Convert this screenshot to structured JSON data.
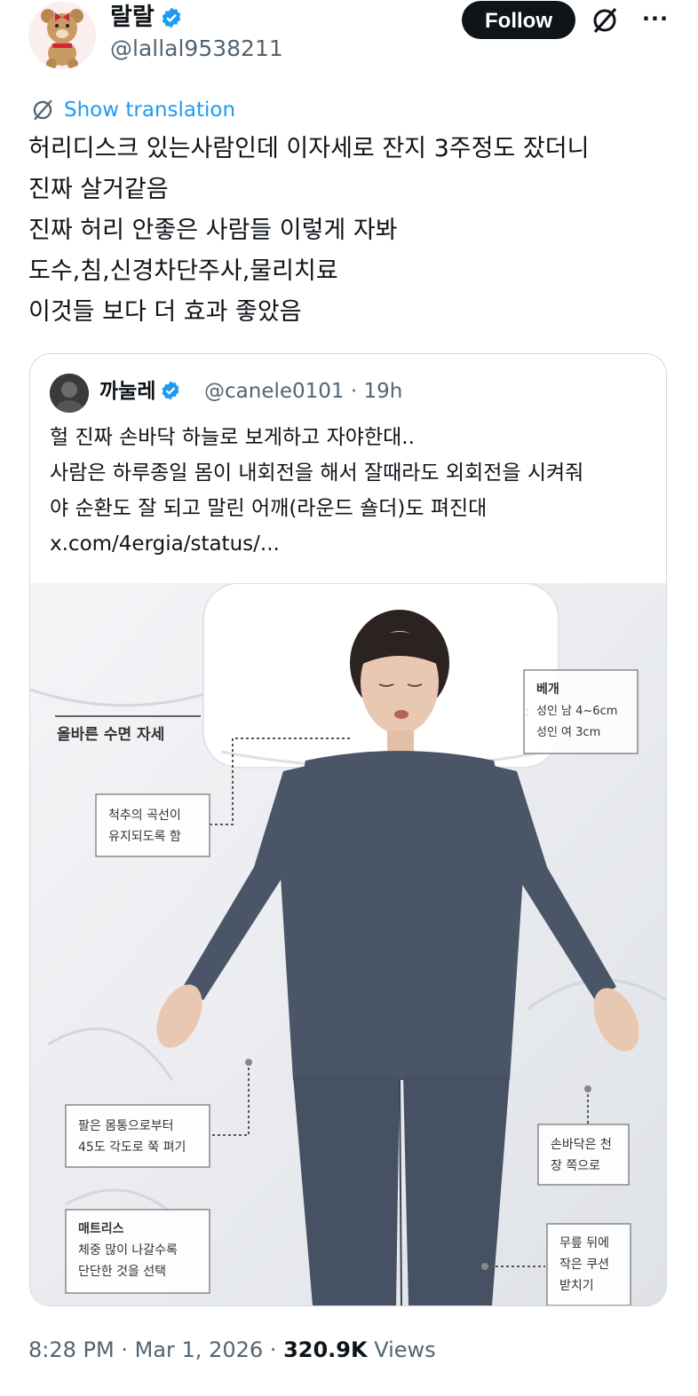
{
  "author": {
    "display_name": "랄랄",
    "handle": "@lallal9538211",
    "avatar_icon": "teddy-bear-avatar",
    "verified_icon": "verified-badge-icon"
  },
  "header": {
    "follow_label": "Follow",
    "grok_icon": "grok-icon",
    "more_label": "···"
  },
  "translation": {
    "icon": "grok-icon",
    "label": "Show translation"
  },
  "post": {
    "lines": [
      "허리디스크 있는사람인데 이자세로 잔지 3주정도 잤더니",
      "진짜 살거같음",
      "진짜 허리 안좋은 사람들 이렇게 자봐",
      "도수,침,신경차단주사,물리치료",
      "이것들 보다 더 효과 좋았음"
    ]
  },
  "quote": {
    "display_name": "까눌레",
    "handle": "@canele0101",
    "separator": "·",
    "time": "19h",
    "lines": [
      "헐 진짜 손바닥 하늘로 보게하고 자야한대..",
      "사람은 하루종일 몸이 내회전을 해서 잘때라도 외회전을 시켜줘",
      "야 순환도 잘 되고 말린 어깨(라운드 숄더)도 펴진대",
      "x.com/4ergia/status/..."
    ],
    "image": {
      "title": "올바른 수면 자세",
      "pillow_title": "베개",
      "pillow_line1": "성인 남 4~6cm",
      "pillow_line2": "성인 여 3cm",
      "spine_line1": "척추의 곡선이",
      "spine_line2": "유지되도록 함",
      "arm_line1": "팔은 몸통으로부터",
      "arm_line2": "45도 각도로 쭉 펴기",
      "palm_line1": "손바닥은 천",
      "palm_line2": "장 쪽으로",
      "mattress_title": "매트리스",
      "mattress_line1": "체중 많이 나갈수록",
      "mattress_line2": "단단한 것을 선택",
      "knee_line1": "무릎 뒤에",
      "knee_line2": "작은 쿠션",
      "knee_line3": "받치기"
    }
  },
  "footer": {
    "time": "8:28 PM",
    "sep1": "·",
    "date": "Mar 1, 2026",
    "sep2": "·",
    "views_count": "320.9K",
    "views_label": "Views"
  },
  "colors": {
    "link": "#1d9bf0",
    "secondary_text": "#536471",
    "verified": "#1d9bf0",
    "follow_bg": "#0f1419",
    "pajama": "#4a5568"
  }
}
